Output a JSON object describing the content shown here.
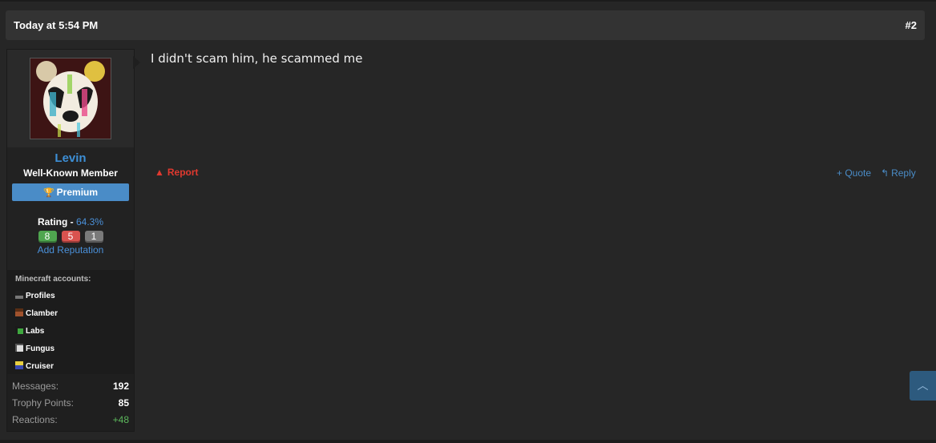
{
  "post": {
    "date": "Today at 5:54 PM",
    "number": "#2",
    "message": "I didn't scam him, he scammed me"
  },
  "user": {
    "name": "Levin",
    "title": "Well-Known Member",
    "badge": "Premium",
    "rating_label": "Rating - ",
    "rating_percent": "64.3%",
    "rating_positive": "8",
    "rating_negative": "5",
    "rating_neutral": "1",
    "add_reputation": "Add Reputation"
  },
  "minecraft": {
    "title": "Minecraft accounts:",
    "accounts": [
      "Profiles",
      "Clamber",
      "Labs",
      "Fungus",
      "Cruiser"
    ]
  },
  "stats": {
    "messages_label": "Messages:",
    "messages_value": "192",
    "trophy_label": "Trophy Points:",
    "trophy_value": "85",
    "reactions_label": "Reactions:",
    "reactions_value": "+48"
  },
  "actions": {
    "report": "Report",
    "quote": "+ Quote",
    "reply": "Reply"
  },
  "colors": {
    "accent": "#4a8cc7",
    "username": "#3d8fd6",
    "report": "#e0392f",
    "positive": "#4fa64f",
    "negative": "#d9534f"
  },
  "icons": {
    "badge": "trophy-icon",
    "report": "warning-icon",
    "reply": "reply-icon",
    "scroll": "chevron-up-icon"
  }
}
